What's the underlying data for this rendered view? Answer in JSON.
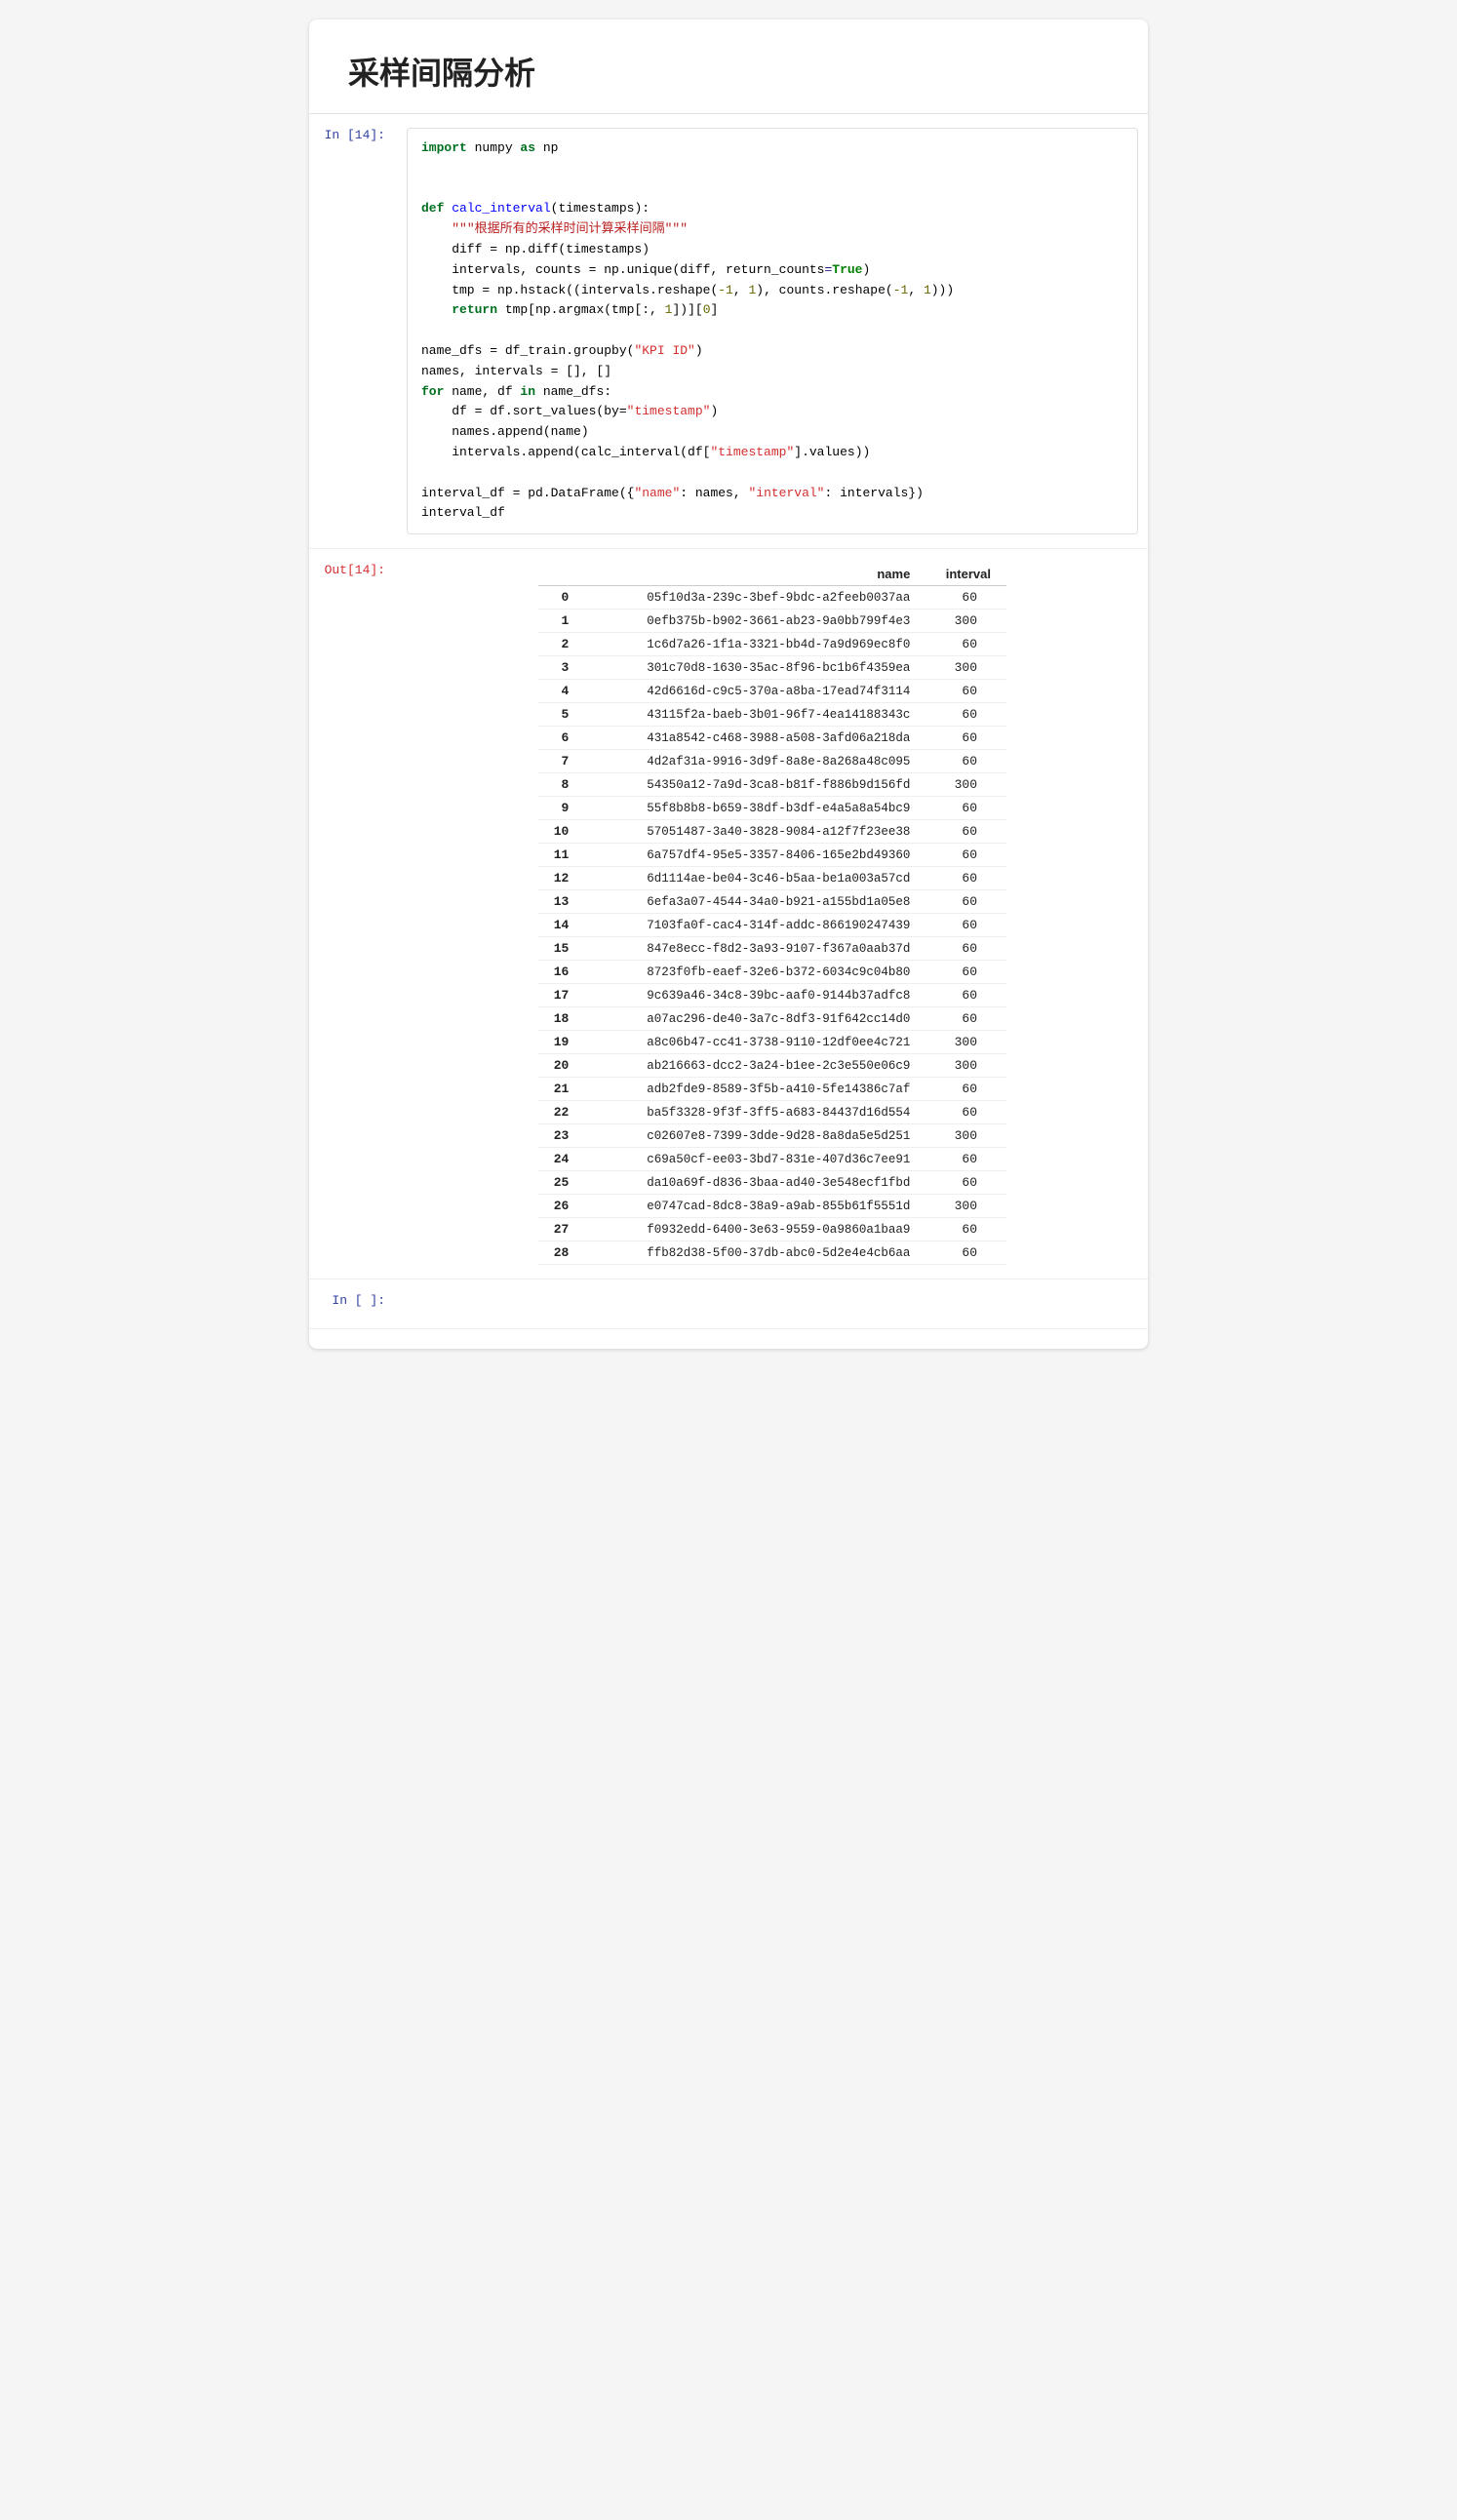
{
  "page": {
    "title": "采样间隔分析"
  },
  "cell_in": {
    "label": "In [14]:",
    "code_lines": []
  },
  "cell_out": {
    "label": "Out[14]:"
  },
  "cell_in_next": {
    "label": "In [ ]:"
  },
  "table": {
    "headers": [
      "",
      "name",
      "interval"
    ],
    "rows": [
      {
        "idx": "0",
        "name": "05f10d3a-239c-3bef-9bdc-a2feeb0037aa",
        "interval": "60"
      },
      {
        "idx": "1",
        "name": "0efb375b-b902-3661-ab23-9a0bb799f4e3",
        "interval": "300"
      },
      {
        "idx": "2",
        "name": "1c6d7a26-1f1a-3321-bb4d-7a9d969ec8f0",
        "interval": "60"
      },
      {
        "idx": "3",
        "name": "301c70d8-1630-35ac-8f96-bc1b6f4359ea",
        "interval": "300"
      },
      {
        "idx": "4",
        "name": "42d6616d-c9c5-370a-a8ba-17ead74f3114",
        "interval": "60"
      },
      {
        "idx": "5",
        "name": "43115f2a-baeb-3b01-96f7-4ea14188343c",
        "interval": "60"
      },
      {
        "idx": "6",
        "name": "431a8542-c468-3988-a508-3afd06a218da",
        "interval": "60"
      },
      {
        "idx": "7",
        "name": "4d2af31a-9916-3d9f-8a8e-8a268a48c095",
        "interval": "60"
      },
      {
        "idx": "8",
        "name": "54350a12-7a9d-3ca8-b81f-f886b9d156fd",
        "interval": "300"
      },
      {
        "idx": "9",
        "name": "55f8b8b8-b659-38df-b3df-e4a5a8a54bc9",
        "interval": "60"
      },
      {
        "idx": "10",
        "name": "57051487-3a40-3828-9084-a12f7f23ee38",
        "interval": "60"
      },
      {
        "idx": "11",
        "name": "6a757df4-95e5-3357-8406-165e2bd49360",
        "interval": "60"
      },
      {
        "idx": "12",
        "name": "6d1114ae-be04-3c46-b5aa-be1a003a57cd",
        "interval": "60"
      },
      {
        "idx": "13",
        "name": "6efa3a07-4544-34a0-b921-a155bd1a05e8",
        "interval": "60"
      },
      {
        "idx": "14",
        "name": "7103fa0f-cac4-314f-addc-866190247439",
        "interval": "60"
      },
      {
        "idx": "15",
        "name": "847e8ecc-f8d2-3a93-9107-f367a0aab37d",
        "interval": "60"
      },
      {
        "idx": "16",
        "name": "8723f0fb-eaef-32e6-b372-6034c9c04b80",
        "interval": "60"
      },
      {
        "idx": "17",
        "name": "9c639a46-34c8-39bc-aaf0-9144b37adfc8",
        "interval": "60"
      },
      {
        "idx": "18",
        "name": "a07ac296-de40-3a7c-8df3-91f642cc14d0",
        "interval": "60"
      },
      {
        "idx": "19",
        "name": "a8c06b47-cc41-3738-9110-12df0ee4c721",
        "interval": "300"
      },
      {
        "idx": "20",
        "name": "ab216663-dcc2-3a24-b1ee-2c3e550e06c9",
        "interval": "300"
      },
      {
        "idx": "21",
        "name": "adb2fde9-8589-3f5b-a410-5fe14386c7af",
        "interval": "60"
      },
      {
        "idx": "22",
        "name": "ba5f3328-9f3f-3ff5-a683-84437d16d554",
        "interval": "60"
      },
      {
        "idx": "23",
        "name": "c02607e8-7399-3dde-9d28-8a8da5e5d251",
        "interval": "300"
      },
      {
        "idx": "24",
        "name": "c69a50cf-ee03-3bd7-831e-407d36c7ee91",
        "interval": "60"
      },
      {
        "idx": "25",
        "name": "da10a69f-d836-3baa-ad40-3e548ecf1fbd",
        "interval": "60"
      },
      {
        "idx": "26",
        "name": "e0747cad-8dc8-38a9-a9ab-855b61f5551d",
        "interval": "300"
      },
      {
        "idx": "27",
        "name": "f0932edd-6400-3e63-9559-0a9860a1baa9",
        "interval": "60"
      },
      {
        "idx": "28",
        "name": "ffb82d38-5f00-37db-abc0-5d2e4e4cb6aa",
        "interval": "60"
      }
    ]
  }
}
